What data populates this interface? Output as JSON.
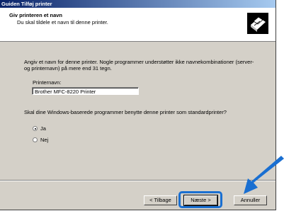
{
  "window": {
    "title": "Guiden Tilføj printer"
  },
  "header": {
    "title": "Giv printeren et navn",
    "subtitle": "Du skal tildele et navn til denne printer."
  },
  "body": {
    "intro": "Angiv et navn for denne printer. Nogle programmer understøtter ikke navnekombinationer (server- og printernavn) på mere end 31 tegn.",
    "printer_name_label": "Printernavn:",
    "printer_name_value": "Brother MFC-8220 Printer",
    "default_question": "Skal dine Windows-baserede programmer benytte denne printer som standardprinter?",
    "options": [
      {
        "label": "Ja",
        "selected": true
      },
      {
        "label": "Nej",
        "selected": false
      }
    ]
  },
  "buttons": {
    "back": "< Tilbage",
    "next": "Næste >",
    "cancel": "Annuller"
  },
  "colors": {
    "highlight": "#1a6fd1",
    "titlebar": "#0a246a"
  },
  "icons": [
    "printer-wizard-icon",
    "pointer-arrow-icon"
  ]
}
